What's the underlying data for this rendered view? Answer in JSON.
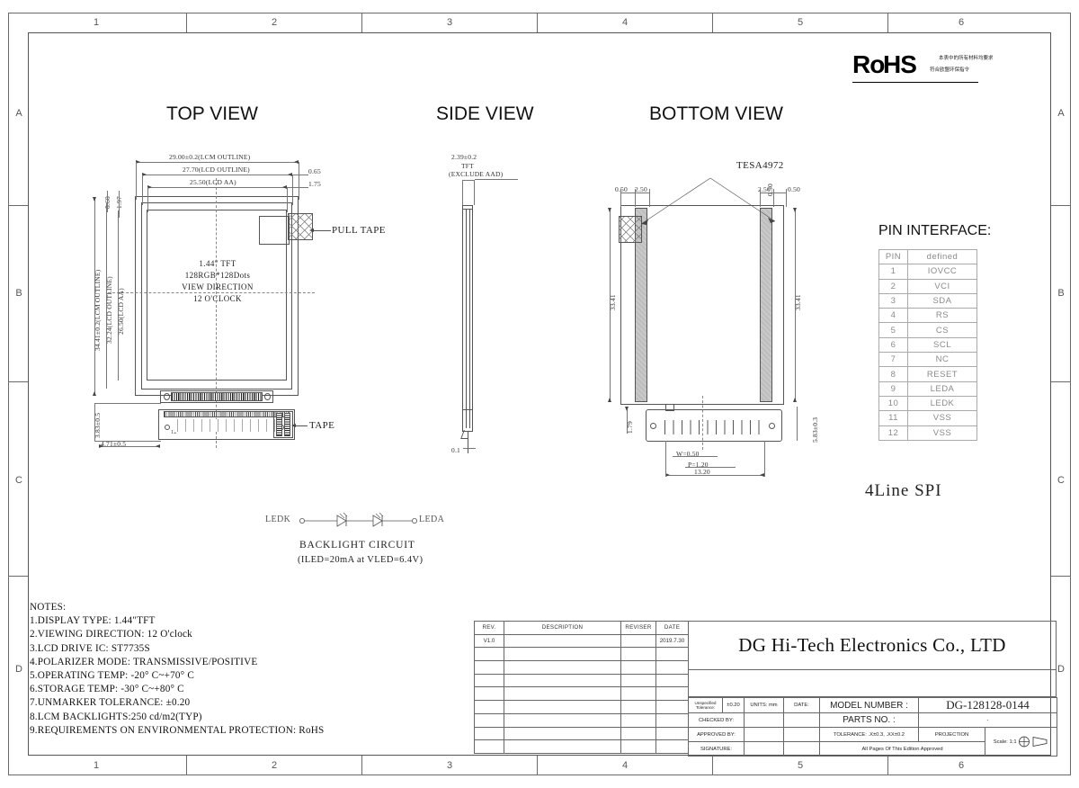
{
  "sheet": {
    "zones_top": [
      "1",
      "2",
      "3",
      "4",
      "5",
      "6"
    ],
    "zones_bottom": [
      "1",
      "2",
      "3",
      "4",
      "5",
      "6"
    ],
    "zones_left": [
      "A",
      "B",
      "C",
      "D"
    ],
    "zones_right": [
      "A",
      "B",
      "C",
      "D"
    ]
  },
  "rohs": {
    "word_ro": "Ro",
    "word_hs": "HS",
    "cn_line1": "本表中的所有材料均要求",
    "cn_line2": "符合欧盟环保指令"
  },
  "views": {
    "top_title": "TOP VIEW",
    "side_title": "SIDE VIEW",
    "bottom_title": "BOTTOM VIEW"
  },
  "top_view": {
    "dim_lcm_width": "29.00±0.2(LCM OUTLINE)",
    "dim_lcd_width": "27.70(LCD OUTLINE)",
    "dim_aa_width": "25.50(LCD AA)",
    "dim_right_065": "0.65",
    "dim_right_175": "1.75",
    "dim_left_060": "0.60",
    "dim_left_197": "1.97",
    "dim_lcm_height": "34.41±0.2(LCM OUTLINE)",
    "dim_lcd_height": "32.24(LCD OUTLINE)",
    "dim_aa_height": "26.50(LCD AA)",
    "dim_bottom_383": "3.83±0.5",
    "dim_bottom_471": "4.71±0.5",
    "center_line1": "1.44″ TFT",
    "center_line2": "128RGB*128Dots",
    "center_line3": "VIEW DIRECTION",
    "center_line4": "12 O'CLOCK",
    "pull_tape_label": "PULL TAPE",
    "tape_label": "TAPE",
    "pin_first": "1",
    "pin_last": "12"
  },
  "side_view": {
    "dim_thickness": "2.39±0.2",
    "dim_note1": "TFT",
    "dim_note2": "(EXCLUDE AAD)",
    "dim_bottom": "0.1"
  },
  "bottom_view": {
    "tesa_label": "TESA4972",
    "dim_left_050": "0.50",
    "dim_left_250": "2.50",
    "dim_mid_050": "0.50",
    "dim_right_250": "2.50",
    "dim_right_050": "0.50",
    "dim_h_left": "33.41",
    "dim_h_right": "33.41",
    "dim_179": "1.79",
    "dim_583": "5.83±0.3",
    "dim_w": "W=0.50",
    "dim_p": "P=1.20",
    "dim_total": "13.20"
  },
  "backlight": {
    "left_pin": "LEDK",
    "right_pin": "LEDA",
    "title": "BACKLIGHT CIRCUIT",
    "subtitle": "(ILED=20mA at VLED=6.4V)"
  },
  "pin_interface": {
    "heading": "PIN INTERFACE:",
    "col_pin": "PIN",
    "col_defined": "defined",
    "rows": [
      {
        "num": "1",
        "name": "IOVCC"
      },
      {
        "num": "2",
        "name": "VCI"
      },
      {
        "num": "3",
        "name": "SDA"
      },
      {
        "num": "4",
        "name": "RS"
      },
      {
        "num": "5",
        "name": "CS"
      },
      {
        "num": "6",
        "name": "SCL"
      },
      {
        "num": "7",
        "name": "NC"
      },
      {
        "num": "8",
        "name": "RESET"
      },
      {
        "num": "9",
        "name": "LEDA"
      },
      {
        "num": "10",
        "name": "LEDK"
      },
      {
        "num": "11",
        "name": "VSS"
      },
      {
        "num": "12",
        "name": "VSS"
      }
    ],
    "interface_label": "4Line SPI"
  },
  "notes": {
    "heading": "NOTES:",
    "items": [
      "1.DISPLAY TYPE:  1.44″TFT",
      "2.VIEWING DIRECTION: 12 O'clock",
      "3.LCD DRIVE IC: ST7735S",
      "4.POLARIZER MODE: TRANSMISSIVE/POSITIVE",
      "5.OPERATING TEMP: -20° C~+70° C",
      "6.STORAGE TEMP: -30° C~+80° C",
      "7.UNMARKER TOLERANCE: ±0.20",
      "8.LCM BACKLIGHTS:250 cd/m2(TYP)",
      "9.REQUIREMENTS ON ENVIRONMENTAL PROTECTION: RoHS"
    ]
  },
  "revision": {
    "headers": [
      "REV.",
      "DESCRIPTION",
      "REVISER",
      "DATE"
    ],
    "rows": [
      {
        "rev": "V1.0",
        "desc": "",
        "reviser": "",
        "date": "2019.7.30"
      },
      {
        "rev": "",
        "desc": "",
        "reviser": "",
        "date": ""
      },
      {
        "rev": "",
        "desc": "",
        "reviser": "",
        "date": ""
      },
      {
        "rev": "",
        "desc": "",
        "reviser": "",
        "date": ""
      },
      {
        "rev": "",
        "desc": "",
        "reviser": "",
        "date": ""
      },
      {
        "rev": "",
        "desc": "",
        "reviser": "",
        "date": ""
      },
      {
        "rev": "",
        "desc": "",
        "reviser": "",
        "date": ""
      },
      {
        "rev": "",
        "desc": "",
        "reviser": "",
        "date": ""
      },
      {
        "rev": "",
        "desc": "",
        "reviser": "",
        "date": ""
      }
    ]
  },
  "title_block": {
    "company": "DG Hi-Tech Electronics Co., LTD",
    "unspecified_tolerance_label": "Unspecified Tolerance:",
    "unspecified_tolerance_value": "±0.20",
    "units_label": "UNITS: mm",
    "date_label": "DATE:",
    "date_value": "",
    "model_number_label": "MODEL NUMBER :",
    "model_number_value": "DG-128128-0144",
    "checked_by_label": "CHECKED  BY:",
    "checked_by_value": "",
    "parts_no_label": "PARTS NO. :",
    "parts_no_value": "-",
    "approved_by_label": "APPROVED BY:",
    "approved_by_value": "",
    "tolerance_label": "TOLERANCE:  .X±0.3, .XX±0.2",
    "projection_label": "PROJECTION",
    "signature_label": "SIGNATURE:",
    "signature_value": "",
    "approval_note": "All Pages Of This Edition Approved",
    "scale_label": "Scale: 1:1"
  }
}
